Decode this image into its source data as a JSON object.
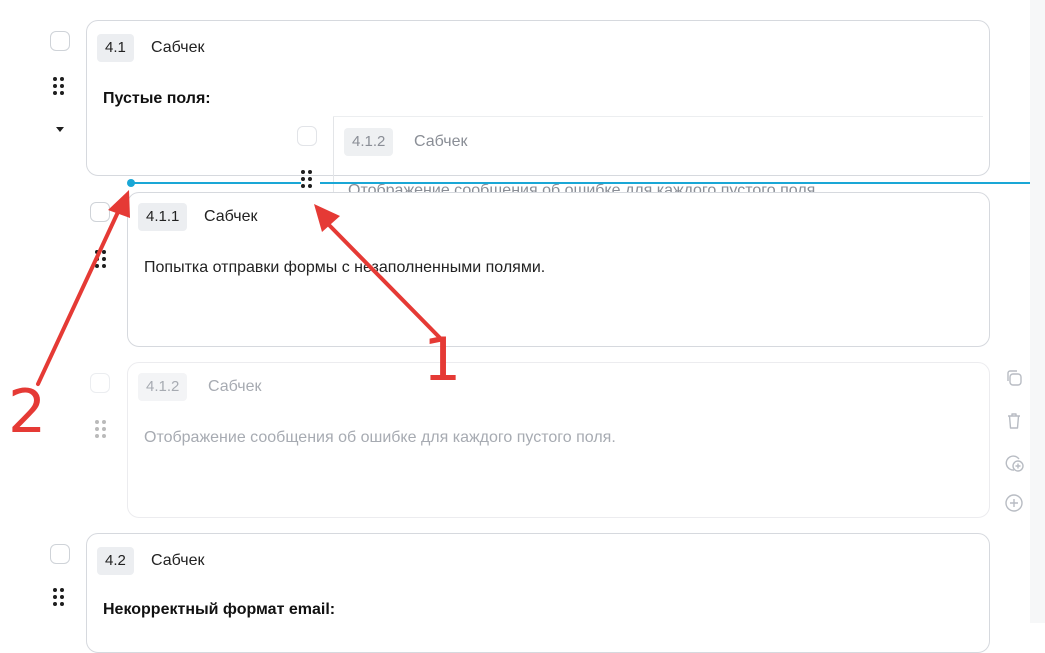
{
  "items": {
    "i41": {
      "num": "4.1",
      "kind": "Сабчек",
      "title": "Пустые поля:"
    },
    "i412_ghost": {
      "num": "4.1.2",
      "kind": "Сабчек",
      "text": "Отображение сообщения об ошибке для каждого пустого поля."
    },
    "i411": {
      "num": "4.1.1",
      "kind": "Сабчек",
      "text": "Попытка отправки формы с незаполненными полями."
    },
    "i412": {
      "num": "4.1.2",
      "kind": "Сабчек",
      "text": "Отображение сообщения об ошибке для каждого пустого поля."
    },
    "i42": {
      "num": "4.2",
      "kind": "Сабчек",
      "title": "Некорректный формат email:"
    }
  },
  "annotations": {
    "label_1": "1",
    "label_2": "2"
  },
  "icons": [
    "checkbox",
    "drag-handle-icon",
    "caret-down-icon",
    "copy-icon",
    "trash-icon",
    "add-nested-icon",
    "add-icon",
    "arrow-icon"
  ],
  "colors": {
    "drop_line": "#1aa7d6",
    "arrow": "#e53a35",
    "border": "#d6d9de",
    "badge_bg": "#eceef1"
  }
}
